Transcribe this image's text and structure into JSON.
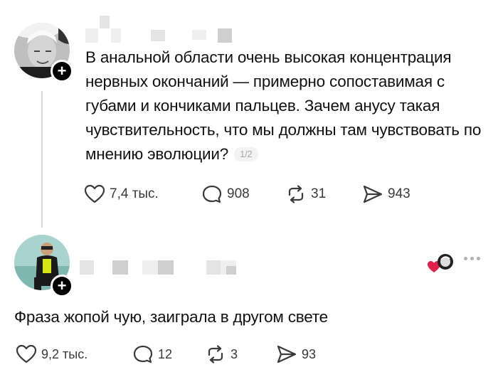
{
  "post": {
    "text": "В анальной области очень высокая концентрация нервных окончаний — примерно сопоставимая с губами и кончиками пальцев. Зачем анусу такая чувствительность, что мы должны там чувствовать по мнению эволюции?",
    "page_indicator": "1/2",
    "likes": "7,4 тыс.",
    "comments": "908",
    "reposts": "31",
    "shares": "943"
  },
  "reply": {
    "text": "Фраза жопой чую, заиграла в другом свете",
    "likes": "9,2 тыс.",
    "comments": "12",
    "reposts": "3",
    "shares": "93"
  },
  "icons": {
    "follow": "plus-icon",
    "like": "heart-icon",
    "comment": "comment-bubble-icon",
    "repost": "repost-icon",
    "share": "send-icon",
    "more": "more-dots-icon",
    "liked_by_author": "red-heart-icon"
  },
  "colors": {
    "text": "#111111",
    "meta": "#3a3a3a",
    "liked_heart": "#e0204a"
  }
}
